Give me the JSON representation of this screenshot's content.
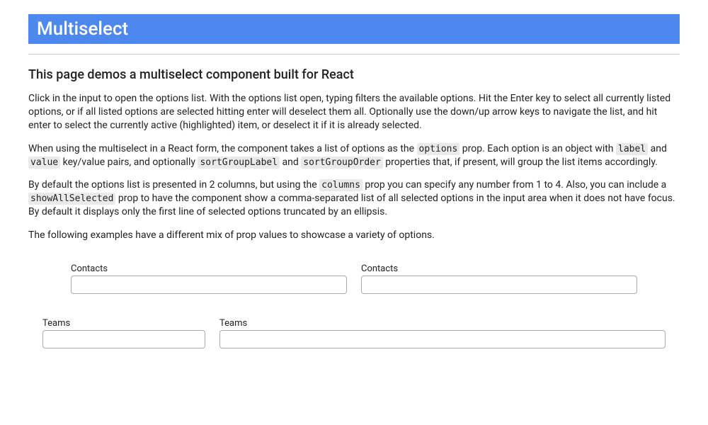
{
  "banner": {
    "title": "Multiselect"
  },
  "subhead": "This page demos a multiselect component built for React",
  "para1": "Click in the input to open the options list. With the options list open, typing filters the available options. Hit the Enter key to select all currently listed options, or if all listed options are selected hitting enter will deselect them all. Optionally use the down/up arrow keys to navigate the list, and hit enter to select the currently active (highlighted) item, or deselect it if it is already selected.",
  "para2": {
    "pre": "When using the multiselect in a React form, the component takes a list of options as the ",
    "code1": "options",
    "mid1": " prop. Each option is an object with ",
    "code2": "label",
    "mid2": " and ",
    "code3": "value",
    "mid3": " key/value pairs, and optionally ",
    "code4": "sortGroupLabel",
    "mid4": " and ",
    "code5": "sortGroupOrder",
    "post": " properties that, if present, will group the list items accordingly."
  },
  "para3": {
    "pre": "By default the options list is presented in 2 columns, but using the ",
    "code1": "columns",
    "mid1": " prop you can specify any number from 1 to 4. Also, you can include a ",
    "code2": "showAllSelected",
    "post": " prop to have the component show a comma-separated list of all selected options in the input area when it does not have focus. By default it displays only the first line of selected options truncated by an ellipsis."
  },
  "para4": "The following examples have a different mix of prop values to showcase a variety of options.",
  "fields": {
    "contacts1": {
      "label": "Contacts",
      "value": ""
    },
    "contacts2": {
      "label": "Contacts",
      "value": ""
    },
    "teams1": {
      "label": "Teams",
      "value": ""
    },
    "teams2": {
      "label": "Teams",
      "value": ""
    }
  }
}
